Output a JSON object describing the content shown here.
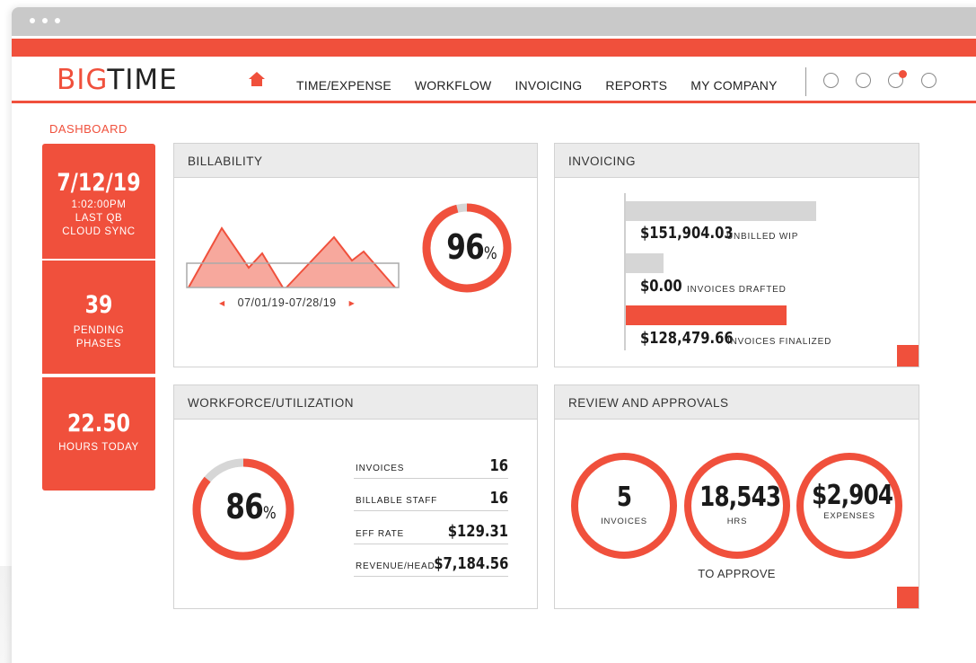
{
  "app": {
    "logo_primary": "BIG",
    "logo_secondary": "TIME"
  },
  "nav": {
    "items": [
      "TIME/EXPENSE",
      "WORKFLOW",
      "INVOICING",
      "REPORTS",
      "MY COMPANY"
    ]
  },
  "colors": {
    "accent": "#f0503c",
    "panel_header": "#ebebeb",
    "neutral_bar": "#d6d6d6"
  },
  "dashboard": {
    "label": "DASHBOARD",
    "tiles": {
      "sync_date": "7/12/19",
      "sync_time": "1:02:00PM",
      "sync_line1": "LAST QB",
      "sync_line2": "CLOUD SYNC",
      "phases_count": "39",
      "phases_line1": "PENDING",
      "phases_line2": "PHASES",
      "hours_value": "22.50",
      "hours_label": "HOURS TODAY"
    }
  },
  "billability": {
    "title": "BILLABILITY",
    "percent_value": 96,
    "percent_num": "96",
    "percent_sign": "%",
    "date_range": "07/01/19-07/28/19"
  },
  "invoicing": {
    "title": "INVOICING",
    "rows": [
      {
        "amount": "$151,904.03",
        "label": "UNBILLED WIP",
        "value": 151904.03
      },
      {
        "amount": "$0.00",
        "label": "INVOICES DRAFTED",
        "value": 0.0
      },
      {
        "amount": "$128,479.66",
        "label": "INVOICES FINALIZED",
        "value": 128479.66
      }
    ]
  },
  "workforce": {
    "title": "WORKFORCE/UTILIZATION",
    "percent_value": 86,
    "percent_num": "86",
    "percent_sign": "%",
    "stats": [
      {
        "label": "INVOICES",
        "value": "16"
      },
      {
        "label": "BILLABLE STAFF",
        "value": "16"
      },
      {
        "label": "EFF RATE",
        "value": "$129.31"
      },
      {
        "label": "REVENUE/HEAD",
        "value": "$7,184.56"
      }
    ]
  },
  "review": {
    "title": "REVIEW AND APPROVALS",
    "items": [
      {
        "value": "5",
        "label": "INVOICES"
      },
      {
        "value": "18,543",
        "label": "HRS"
      },
      {
        "value": "$2,904",
        "label": "EXPENSES"
      }
    ],
    "footer": "TO APPROVE"
  }
}
